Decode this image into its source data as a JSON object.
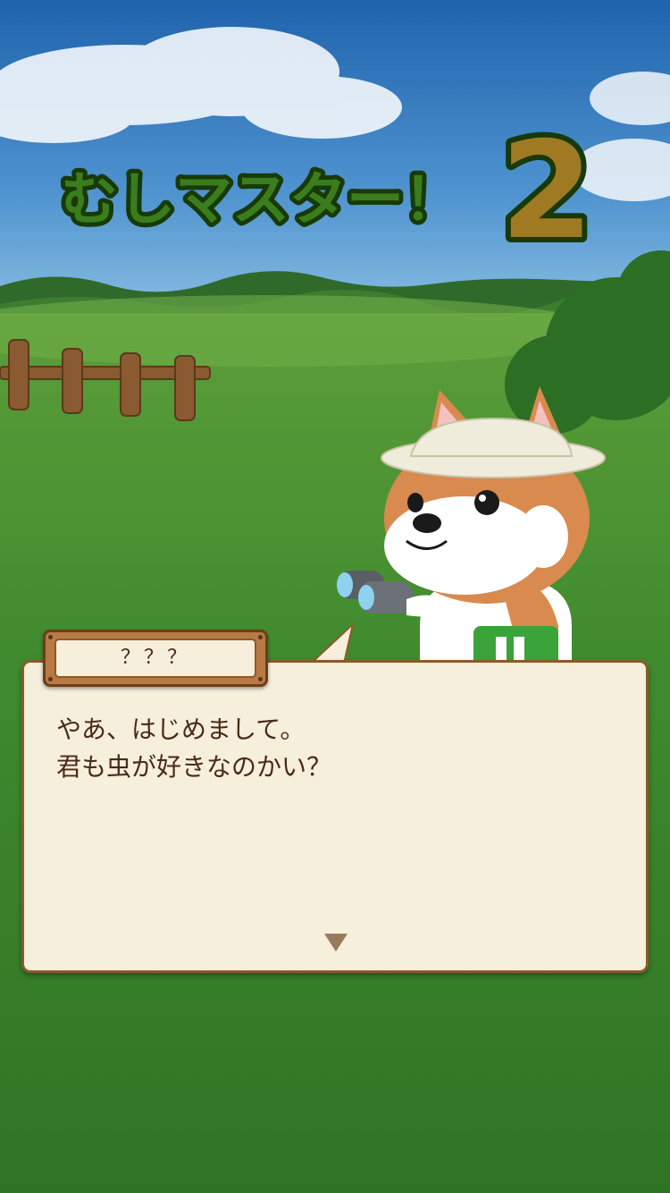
{
  "game": {
    "logo_text": "むしマスター！",
    "logo_number": "2"
  },
  "dialog": {
    "speaker": "？？？",
    "lines": [
      "やあ、はじめまして。",
      "君も虫が好きなのかい？"
    ],
    "next_indicator": "▼"
  },
  "colors": {
    "sky_top": "#2a6fb8",
    "grass": "#3f8a2e",
    "logo_green": "#3b7d1c",
    "logo_gold": "#a07a22",
    "dialog_bg": "#f5efdc",
    "dialog_border": "#8b5a2b",
    "dialog_text": "#4a2a14"
  }
}
